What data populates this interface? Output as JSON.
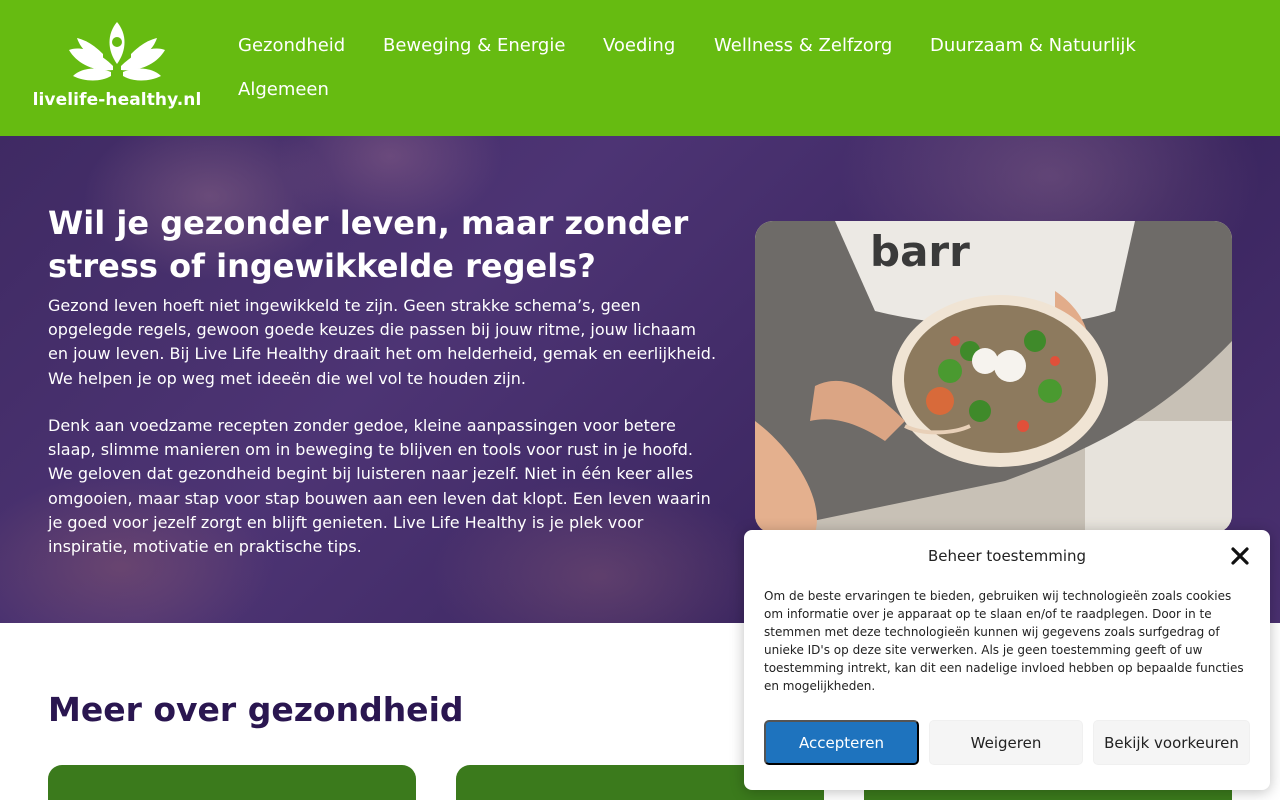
{
  "colors": {
    "header_bg": "#66bb11",
    "hero_bg": "#3f2a63",
    "accent_button": "#1e73be",
    "heading_dark": "#2a1650",
    "card_green": "#3b7a1c"
  },
  "header": {
    "logo_text": "livelife-healthy.nl",
    "logo_icon": "lotus-icon",
    "nav": [
      {
        "label": "Gezondheid"
      },
      {
        "label": "Beweging & Energie"
      },
      {
        "label": "Voeding"
      },
      {
        "label": "Wellness & Zelfzorg"
      },
      {
        "label": "Duurzaam & Natuurlijk"
      },
      {
        "label": "Algemeen"
      }
    ]
  },
  "hero": {
    "title": "Wil je gezonder leven, maar zonder stress of ingewikkelde regels?",
    "paragraph_1": "Gezond leven hoeft niet ingewikkeld te zijn. Geen strakke schema’s, geen opgelegde regels, gewoon goede keuzes die passen bij jouw ritme, jouw lichaam en jouw leven. Bij Live Life Healthy draait het om helderheid, gemak en eerlijkheid. We helpen je op weg met ideeën die wel vol te houden zijn.",
    "paragraph_2": "Denk aan voedzame recepten zonder gedoe, kleine aanpassingen voor betere slaap, slimme manieren om in beweging te blijven en tools voor rust in je hoofd. We geloven dat gezondheid begint bij luisteren naar jezelf. Niet in één keer alles omgooien, maar stap voor stap bouwen aan een leven dat klopt. Een leven waarin je goed voor jezelf zorgt en blijft genieten. Live Life Healthy is je plek voor inspiratie, motivatie en praktische tips.",
    "photo_shirt_text": "barr"
  },
  "section": {
    "title": "Meer over gezondheid"
  },
  "cookie": {
    "title": "Beheer toestemming",
    "text": "Om de beste ervaringen te bieden, gebruiken wij technologieën zoals cookies om informatie over je apparaat op te slaan en/of te raadplegen. Door in te stemmen met deze technologieën kunnen wij gegevens zoals surfgedrag of unieke ID's op deze site verwerken. Als je geen toestemming geeft of uw toestemming intrekt, kan dit een nadelige invloed hebben op bepaalde functies en mogelijkheden.",
    "accept_label": "Accepteren",
    "deny_label": "Weigeren",
    "prefs_label": "Bekijk voorkeuren",
    "close_icon": "close-icon"
  }
}
